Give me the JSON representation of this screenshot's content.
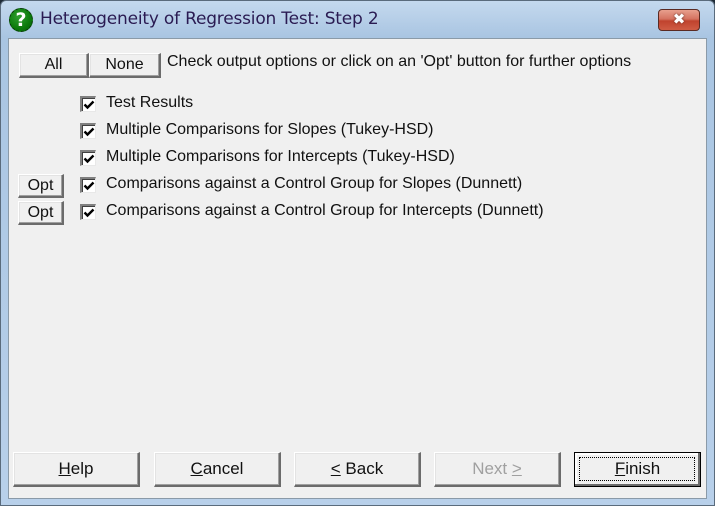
{
  "window": {
    "title": "Heterogeneity of Regression Test: Step 2",
    "title_icon": "help-question-icon",
    "close_icon": "close-x-icon",
    "close_glyph": "✖"
  },
  "toolbar": {
    "all_label": "All",
    "none_label": "None",
    "instruction": "Check output options or click on an 'Opt' button for further options"
  },
  "options": [
    {
      "label": "Test Results",
      "checked": true,
      "has_opt": false
    },
    {
      "label": "Multiple Comparisons for Slopes (Tukey-HSD)",
      "checked": true,
      "has_opt": false
    },
    {
      "label": "Multiple Comparisons for Intercepts (Tukey-HSD)",
      "checked": true,
      "has_opt": false
    },
    {
      "label": "Comparisons against a Control Group for Slopes (Dunnett)",
      "checked": true,
      "has_opt": true,
      "opt_label": "Opt"
    },
    {
      "label": "Comparisons against a Control Group for Intercepts (Dunnett)",
      "checked": true,
      "has_opt": true,
      "opt_label": "Opt"
    }
  ],
  "footer": {
    "help": {
      "pre": "",
      "mnemonic": "H",
      "post": "elp",
      "enabled": true
    },
    "cancel": {
      "pre": "",
      "mnemonic": "C",
      "post": "ancel",
      "enabled": true
    },
    "back": {
      "pre": "",
      "mnemonic": "<",
      "post": " Back",
      "enabled": true
    },
    "next": {
      "pre": "Next ",
      "mnemonic": ">",
      "post": "",
      "enabled": false
    },
    "finish": {
      "pre": "",
      "mnemonic": "F",
      "post": "inish",
      "enabled": true,
      "default": true
    }
  }
}
